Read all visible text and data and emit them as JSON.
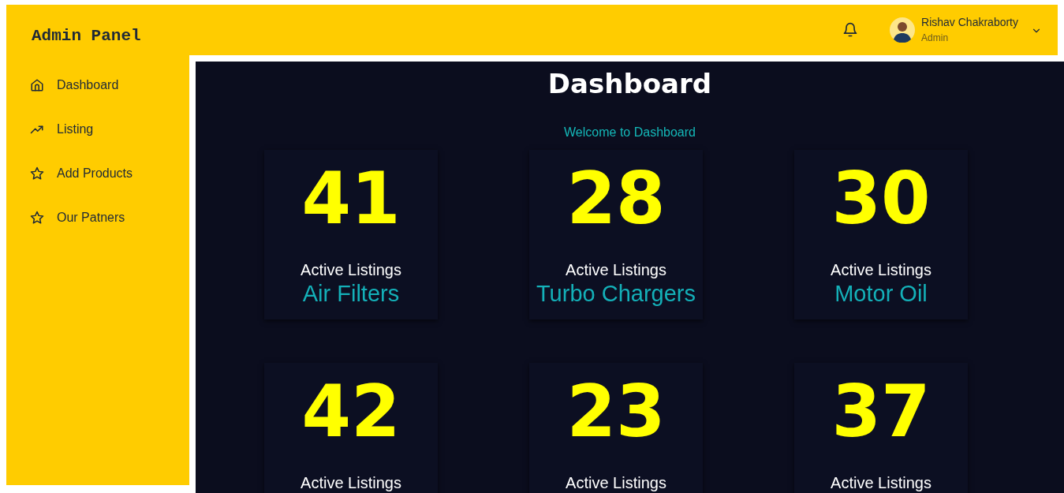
{
  "header": {
    "brand": "Admin Panel",
    "user": {
      "name": "Rishav Chakraborty",
      "role": "Admin"
    }
  },
  "sidebar": {
    "items": [
      {
        "label": "Dashboard"
      },
      {
        "label": "Listing"
      },
      {
        "label": "Add Products"
      },
      {
        "label": "Our Patners"
      }
    ]
  },
  "main": {
    "title": "Dashboard",
    "subtitle": "Welcome to Dashboard",
    "cards": [
      {
        "count": "41",
        "label": "Active Listings",
        "category": "Air Filters"
      },
      {
        "count": "28",
        "label": "Active Listings",
        "category": "Turbo Chargers"
      },
      {
        "count": "30",
        "label": "Active Listings",
        "category": "Motor Oil"
      },
      {
        "count": "42",
        "label": "Active Listings"
      },
      {
        "count": "23",
        "label": "Active Listings"
      },
      {
        "count": "37",
        "label": "Active Listings"
      }
    ]
  }
}
